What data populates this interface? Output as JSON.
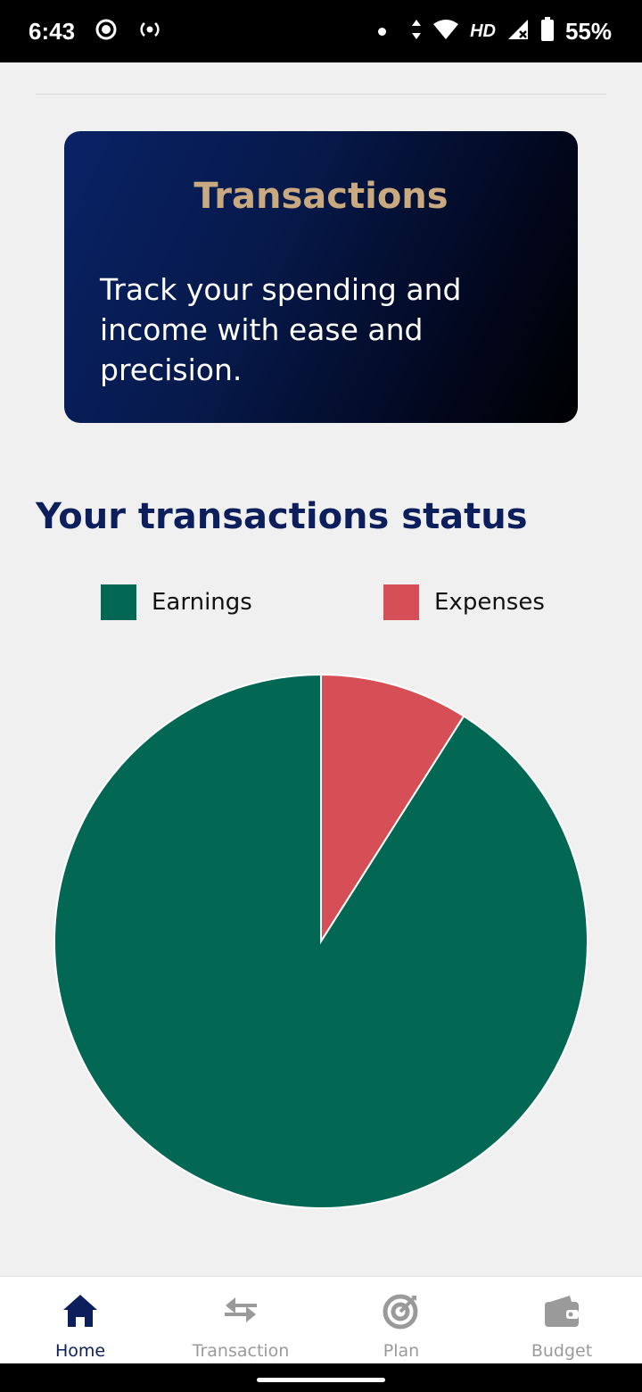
{
  "status_bar": {
    "time": "6:43",
    "network": "HD",
    "battery": "55%"
  },
  "banner": {
    "title": "Transactions",
    "description": "Track your spending and income with ease and precision."
  },
  "section_title": "Your transactions status",
  "legend": [
    {
      "label": "Earnings",
      "color": "#026853"
    },
    {
      "label": "Expenses",
      "color": "#d64f56"
    }
  ],
  "chart_data": {
    "type": "pie",
    "labels": [
      "Earnings",
      "Expenses"
    ],
    "values": [
      91,
      9
    ],
    "colors": [
      "#026853",
      "#d64f56"
    ],
    "title": "",
    "legend_position": "top"
  },
  "bottom_nav": {
    "items": [
      {
        "label": "Home",
        "icon": "home-icon",
        "active": true
      },
      {
        "label": "Transaction",
        "icon": "swap-arrows-icon",
        "active": false
      },
      {
        "label": "Plan",
        "icon": "target-icon",
        "active": false
      },
      {
        "label": "Budget",
        "icon": "wallet-icon",
        "active": false
      }
    ]
  }
}
